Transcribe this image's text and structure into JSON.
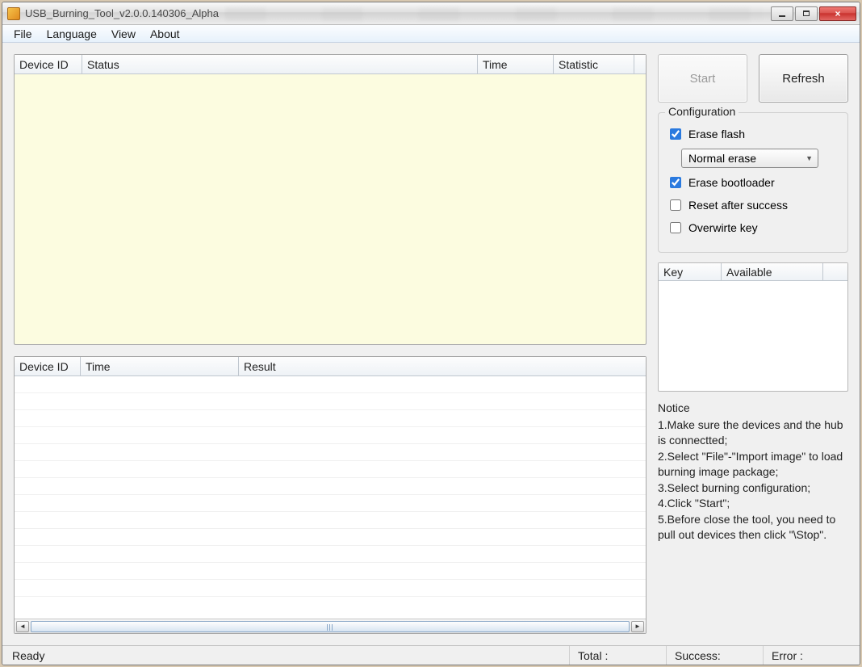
{
  "window": {
    "title": "USB_Burning_Tool_v2.0.0.140306_Alpha"
  },
  "menu": {
    "file": "File",
    "language": "Language",
    "view": "View",
    "about": "About"
  },
  "buttons": {
    "start": "Start",
    "refresh": "Refresh"
  },
  "tables": {
    "device": {
      "cols": {
        "device_id": "Device ID",
        "status": "Status",
        "time": "Time",
        "statistic": "Statistic"
      }
    },
    "result": {
      "cols": {
        "device_id": "Device ID",
        "time": "Time",
        "result": "Result"
      }
    },
    "key": {
      "cols": {
        "key": "Key",
        "available": "Available"
      }
    }
  },
  "config": {
    "legend": "Configuration",
    "erase_flash": {
      "label": "Erase flash",
      "checked": true
    },
    "erase_mode": {
      "selected": "Normal erase"
    },
    "erase_bootloader": {
      "label": "Erase bootloader",
      "checked": true
    },
    "reset_after_success": {
      "label": "Reset after success",
      "checked": false
    },
    "overwrite_key": {
      "label": "Overwirte key",
      "checked": false
    }
  },
  "notice": {
    "title": "Notice",
    "items": [
      "1.Make sure the devices and the hub is connectted;",
      "2.Select \"File\"-\"Import image\" to load burning image package;",
      "3.Select burning configuration;",
      "4.Click \"Start\";",
      "5.Before close the tool, you need to pull out devices then click \"\\Stop\"."
    ]
  },
  "statusbar": {
    "ready": "Ready",
    "total": "Total :",
    "success": "Success:",
    "error": "Error :"
  }
}
